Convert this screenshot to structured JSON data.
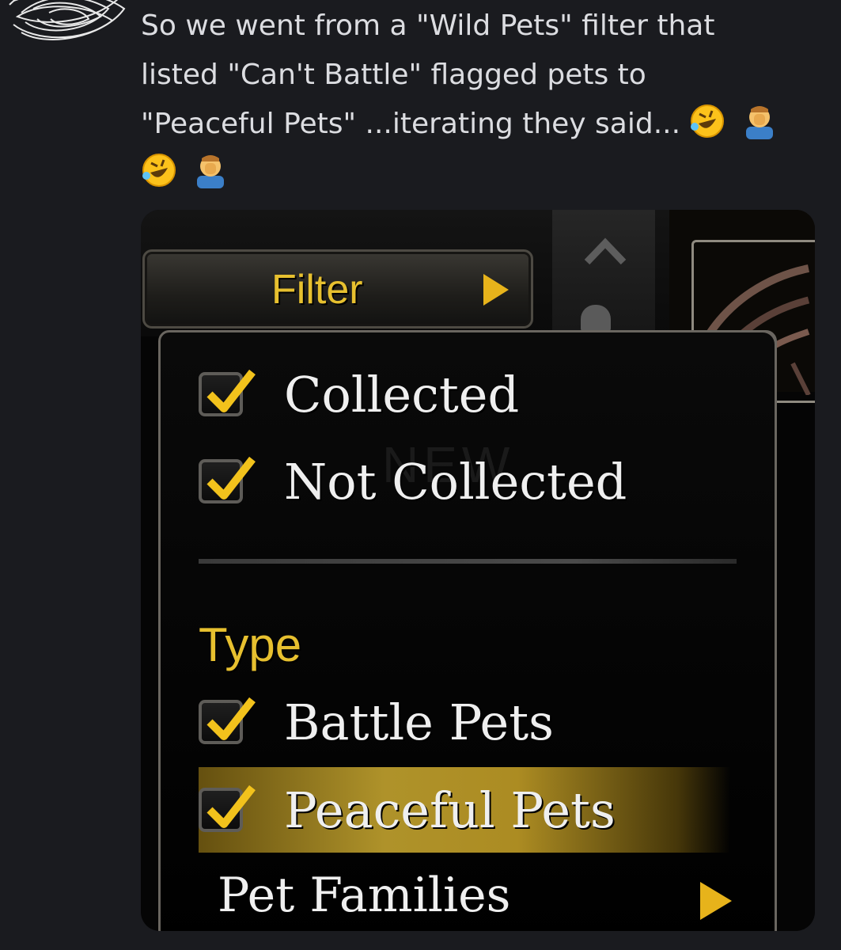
{
  "message": {
    "lines": [
      "So we went from a \"Wild Pets\" filter that",
      "listed \"Can't Battle\" flagged pets to",
      "\"Peaceful Pets\" ...iterating they said..."
    ],
    "emojis": [
      "rolling-on-floor-laughing",
      "facepalm"
    ]
  },
  "game_ui": {
    "filter_button_label": "Filter",
    "ghost_text": "NEW",
    "items": [
      {
        "label": "Collected",
        "checked": true
      },
      {
        "label": "Not Collected",
        "checked": true
      }
    ],
    "type_section_label": "Type",
    "type_items": [
      {
        "label": "Battle Pets",
        "checked": true
      },
      {
        "label": "Peaceful Pets",
        "checked": true,
        "highlighted": true
      }
    ],
    "submenu_label": "Pet Families",
    "colors": {
      "gold": "#e7c02f",
      "check": "#f2c21c",
      "highlight": "#b89a2c"
    }
  }
}
